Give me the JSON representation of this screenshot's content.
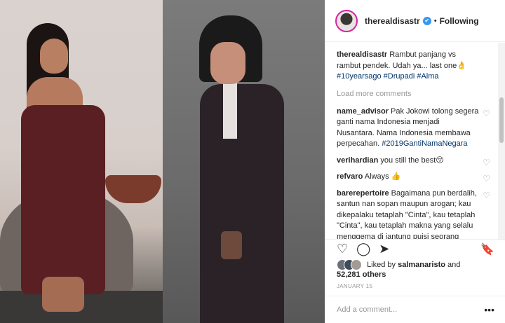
{
  "post": {
    "username": "therealdisastr",
    "dot": "•",
    "follow_label": "Following",
    "caption_user": "therealdisastr",
    "caption_text": "Rambut panjang vs rambut pendek. Udah ya... last one👌",
    "caption_tags": "#10yearsago #Drupadi #Alma",
    "load_more": "Load more comments",
    "likes_text": "Liked by",
    "liked_by_user": "salmanaristo",
    "and_text": "and",
    "likes_count": "52,281 others",
    "date": "JANUARY 15",
    "comment_placeholder": "Add a comment...",
    "more_icon": "•••"
  },
  "comments": [
    {
      "user": "name_advisor",
      "text": "Pak Jokowi tolong segera ganti nama Indonesia menjadi Nusantara. Nama Indonesia membawa perpecahan.",
      "tag": "#2019GantiNamaNegara"
    },
    {
      "user": "verihardian",
      "text": "you still the best😚",
      "tag": ""
    },
    {
      "user": "refvaro",
      "text": "Always 👍",
      "tag": ""
    },
    {
      "user": "barerepertoire",
      "text": "Bagaimana pun berdalih, santun nan sopan maupun arogan; kau dikepalaku tetaplah \"Cinta\", kau tetaplah \"Cinta\", kau tetaplah makna yang selalu menggema di jantung puisi seorang 'Rangga. Kau tetaplah \"Cinta\", kau tetaplah \"Cinta\".",
      "tag": ""
    }
  ],
  "icons": {
    "heart": "♡",
    "comment": "◯",
    "share": "➤",
    "save": "🔖",
    "check": "✔"
  },
  "colors": {
    "accent": "#3897f0",
    "tag": "#003569",
    "muted": "#999999"
  }
}
